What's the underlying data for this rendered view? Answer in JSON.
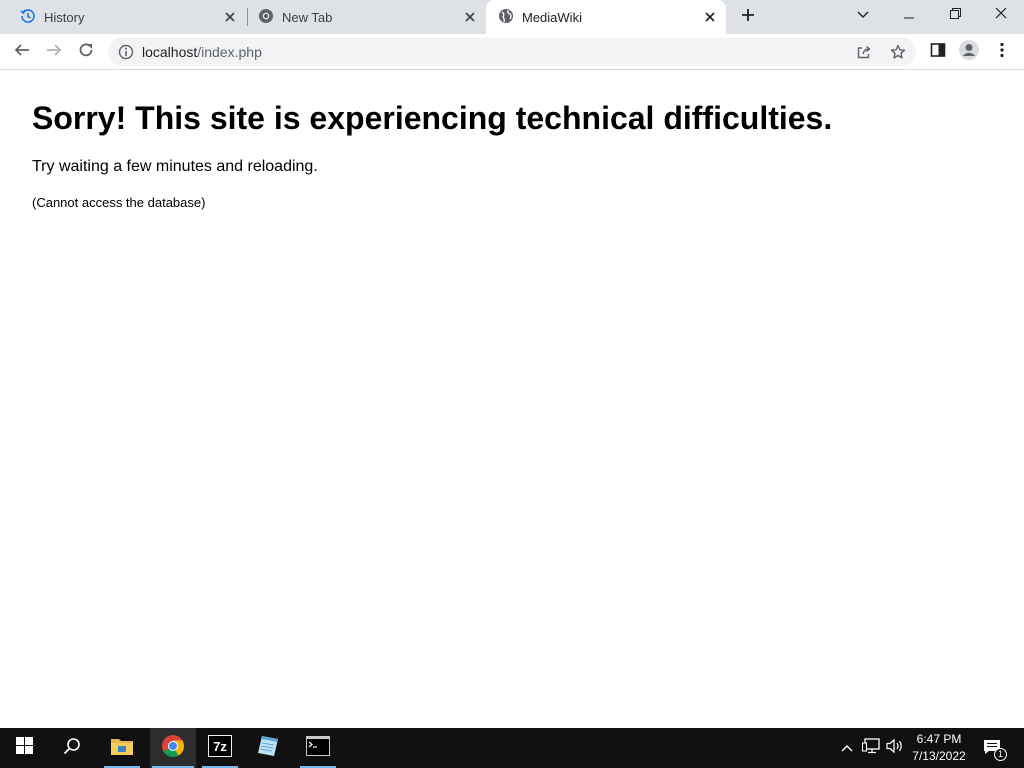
{
  "browser": {
    "tabs": [
      {
        "label": "History",
        "icon": "history-icon"
      },
      {
        "label": "New Tab",
        "icon": "chrome-icon"
      },
      {
        "label": "MediaWiki",
        "icon": "globe-icon",
        "active": true
      }
    ],
    "url": {
      "host": "localhost",
      "path": "/index.php"
    }
  },
  "page": {
    "title": "Sorry! This site is experiencing technical difficulties.",
    "message": "Try waiting a few minutes and reloading.",
    "detail": "(Cannot access the database)"
  },
  "taskbar": {
    "apps": [
      "file-explorer-icon",
      "chrome-icon",
      "7zip-icon",
      "notepad-icon",
      "command-prompt-icon"
    ],
    "time": "6:47 PM",
    "date": "7/13/2022",
    "notification_count": "1"
  },
  "colors": {
    "tabstrip": "#dee1e6",
    "toolbar": "#ffffff",
    "taskbar": "#101010",
    "accent": "#76b9ed"
  }
}
